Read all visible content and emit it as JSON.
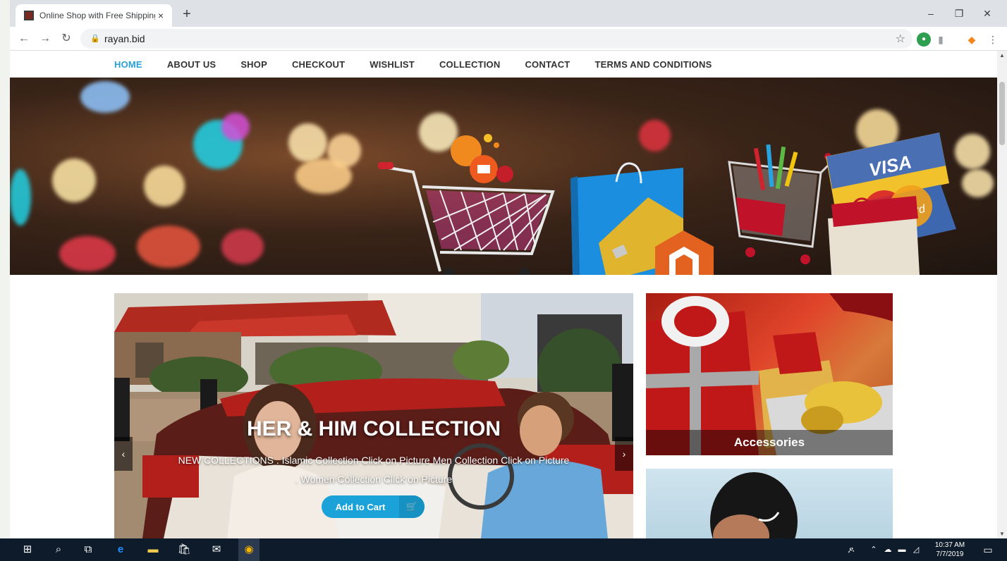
{
  "browser": {
    "tab_title": "Online Shop with Free Shipping",
    "tab_close": "×",
    "new_tab": "+",
    "url": "rayan.bid",
    "minimize": "–",
    "restore": "❐",
    "close": "✕"
  },
  "site_nav": {
    "items": [
      {
        "label": "HOME",
        "active": true
      },
      {
        "label": "ABOUT US"
      },
      {
        "label": "SHOP"
      },
      {
        "label": "CHECKOUT"
      },
      {
        "label": "WISHLIST"
      },
      {
        "label": "COLLECTION"
      },
      {
        "label": "CONTACT"
      },
      {
        "label": "TERMS AND CONDITIONS"
      }
    ]
  },
  "slider": {
    "headline": "HER & HIM COLLECTION",
    "subtitle": "NEW COLLECTIONS . Islamic Collection Click on Picture Men Collection Click on Picture . Women Collection Click on Picture",
    "button_label": "Add to Cart",
    "prev": "‹",
    "next": "›"
  },
  "accessories": {
    "caption": "Accessories"
  },
  "banner_text": {
    "visa": "VISA",
    "mastercard": "MasterCard"
  },
  "taskbar": {
    "time": "10:37 AM",
    "date": "7/7/2019"
  },
  "colors": {
    "accent": "#2a9fd6",
    "cart_button": "#1ba3d9",
    "taskbar": "#0d1b2a"
  }
}
